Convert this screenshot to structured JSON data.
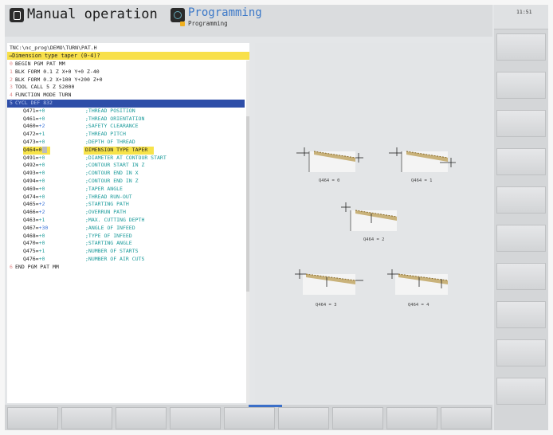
{
  "header": {
    "mode_left": "Manual operation",
    "mode_right": "Programming",
    "mode_right_sub": "Programming",
    "clock": "11:51"
  },
  "editor": {
    "path": "TNC:\\nc_prog\\DEMO\\TURN\\PAT.H",
    "dialog": "→Dimension type taper (0-4)?",
    "lines": [
      {
        "num": "0",
        "text": "BEGIN PGM PAT MM"
      },
      {
        "num": "1",
        "text": "BLK FORM 0.1 Z X+0 Y+0 Z-40"
      },
      {
        "num": "2",
        "text": "BLK FORM 0.2  X+100  Y+200  Z+0"
      },
      {
        "num": "3",
        "text": "TOOL CALL 5 Z S2000"
      },
      {
        "num": "4",
        "text": "FUNCTION MODE TURN"
      },
      {
        "num": "5",
        "text": "CYCL DEF 832"
      }
    ],
    "params": [
      {
        "name": "Q471=",
        "value": "+0",
        "comment": ";THREAD POSITION"
      },
      {
        "name": "Q461=",
        "value": "+0",
        "comment": ";THREAD ORIENTATION"
      },
      {
        "name": "Q460=",
        "value": "+2",
        "comment": ";SAFETY CLEARANCE"
      },
      {
        "name": "Q472=",
        "value": "+1",
        "comment": ";THREAD PITCH"
      },
      {
        "name": "Q473=",
        "value": "+0",
        "comment": ";DEPTH OF THREAD"
      },
      {
        "name": "Q464=",
        "value": "0",
        "comment": "DIMENSION TYPE TAPER"
      },
      {
        "name": "Q491=",
        "value": "+0",
        "comment": ";DIAMETER AT CONTOUR START"
      },
      {
        "name": "Q492=",
        "value": "+0",
        "comment": ";CONTOUR START IN Z"
      },
      {
        "name": "Q493=",
        "value": "+0",
        "comment": ";CONTOUR END IN X"
      },
      {
        "name": "Q494=",
        "value": "+0",
        "comment": ";CONTOUR END IN Z"
      },
      {
        "name": "Q469=",
        "value": "+0",
        "comment": ";TAPER ANGLE"
      },
      {
        "name": "Q474=",
        "value": "+0",
        "comment": ";THREAD RUN-OUT"
      },
      {
        "name": "Q465=",
        "value": "+2",
        "comment": ";STARTING PATH"
      },
      {
        "name": "Q466=",
        "value": "+2",
        "comment": ";OVERRUN PATH"
      },
      {
        "name": "Q463=",
        "value": "+1",
        "comment": ";MAX. CUTTING DEPTH"
      },
      {
        "name": "Q467=",
        "value": "+30",
        "comment": ";ANGLE OF INFEED"
      },
      {
        "name": "Q468=",
        "value": "+0",
        "comment": ";TYPE OF INFEED"
      },
      {
        "name": "Q470=",
        "value": "+0",
        "comment": ";STARTING ANGLE"
      },
      {
        "name": "Q475=",
        "value": "+1",
        "comment": ";NUMBER OF STARTS"
      },
      {
        "name": "Q476=",
        "value": "+0",
        "comment": ";NUMBER OF AIR CUTS"
      }
    ],
    "end_line": {
      "num": "6",
      "text": "END PGM PAT MM"
    }
  },
  "graphics": {
    "captions": [
      "Q464 = 0",
      "Q464 = 1",
      "Q464 = 2",
      "Q464 = 3",
      "Q464 = 4"
    ]
  },
  "colors": {
    "accent_blue": "#2e4ea8",
    "highlight_yellow": "#f7e34a",
    "value_cyan": "#2aa0a0"
  }
}
